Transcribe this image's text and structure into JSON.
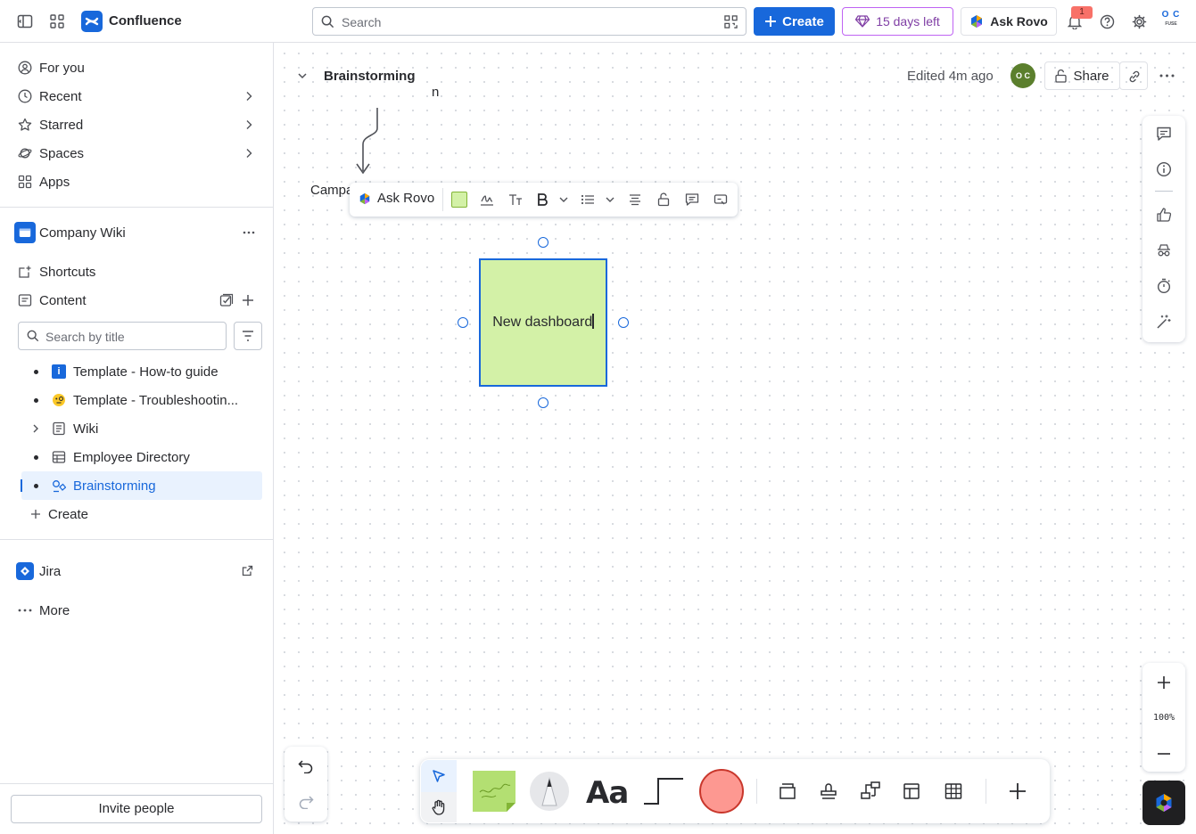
{
  "app": {
    "title": "Confluence"
  },
  "topbar": {
    "search_placeholder": "Search",
    "create_label": "Create",
    "trial_label": "15 days left",
    "ask_rovo_label": "Ask Rovo",
    "notification_count": "1",
    "avatar_initials_top": "O C",
    "avatar_initials_bottom": "FUSE"
  },
  "sidebar": {
    "nav": [
      {
        "label": "For you",
        "icon": "user-circle-icon",
        "has_chevron": false
      },
      {
        "label": "Recent",
        "icon": "clock-icon",
        "has_chevron": true
      },
      {
        "label": "Starred",
        "icon": "star-icon",
        "has_chevron": true
      },
      {
        "label": "Spaces",
        "icon": "planet-icon",
        "has_chevron": true
      },
      {
        "label": "Apps",
        "icon": "apps-icon",
        "has_chevron": false
      }
    ],
    "space": {
      "name": "Company Wiki"
    },
    "shortcuts_label": "Shortcuts",
    "content_label": "Content",
    "filter_placeholder": "Search by title",
    "tree": [
      {
        "label": "Template - How-to guide",
        "icon": "info-icon",
        "selected": false,
        "expandable": false
      },
      {
        "label": "Template - Troubleshootin...",
        "icon": "face-monocle-icon",
        "selected": false,
        "expandable": false
      },
      {
        "label": "Wiki",
        "icon": "page-icon",
        "selected": false,
        "expandable": true
      },
      {
        "label": "Employee Directory",
        "icon": "database-icon",
        "selected": false,
        "expandable": false
      },
      {
        "label": "Brainstorming",
        "icon": "whiteboard-icon",
        "selected": true,
        "expandable": false
      }
    ],
    "create_label": "Create",
    "jira_label": "Jira",
    "more_label": "More",
    "invite_label": "Invite people"
  },
  "board": {
    "title": "Brainstorming",
    "edited": "Edited 4m ago",
    "collaborator_initials": "O C",
    "share_label": "Share",
    "partial_label": "n",
    "campaign_label": "Campa",
    "zoom_level": "100%"
  },
  "format_toolbar": {
    "ask_rovo_label": "Ask Rovo",
    "sticky_color": "#d3f1a7"
  },
  "sticky": {
    "text": "New dashboard",
    "color": "#d3f1a7"
  },
  "colors": {
    "brand": "#1868db",
    "selected_bg": "#e9f2fe",
    "trial": "#803fa5",
    "shape_fill": "#fd9891"
  }
}
